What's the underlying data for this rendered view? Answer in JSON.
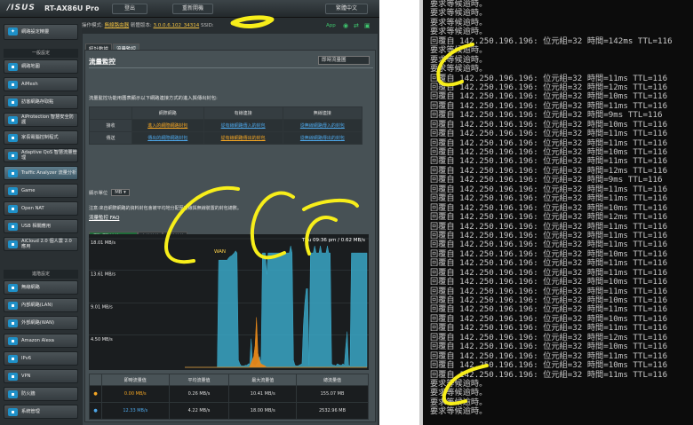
{
  "app": {
    "logo": "/ISUS",
    "model": "RT-AX86U Pro"
  },
  "topbar": {
    "logout": "登出",
    "reboot": "重新開機",
    "language": "繁體中文"
  },
  "infobar": {
    "mode_label": "操作模式:",
    "mode_value": "無線路由器",
    "fw_label": "韌體版本:",
    "fw_value": "3.0.0.6.102_34314",
    "ssid_label": "SSID:",
    "app_label": "App"
  },
  "sidebar": {
    "quick_setup": "網路設定精靈",
    "general_header": "一般設定",
    "general_items": [
      {
        "label": "網路地圖",
        "icon": "map-icon"
      },
      {
        "label": "AiMesh",
        "icon": "mesh-icon"
      },
      {
        "label": "訪客網路存取點",
        "icon": "guest-icon"
      },
      {
        "label": "AiProtection 智慧安全防護",
        "icon": "shield-icon"
      },
      {
        "label": "家長電腦控制程式",
        "icon": "parental-icon"
      },
      {
        "label": "Adaptive QoS 智慧流量管理",
        "icon": "qos-icon"
      },
      {
        "label": "Traffic Analyzer 流量分析",
        "icon": "chart-icon"
      },
      {
        "label": "Game",
        "icon": "game-icon"
      },
      {
        "label": "Open NAT",
        "icon": "nat-icon"
      },
      {
        "label": "USB 相關應用",
        "icon": "usb-icon"
      },
      {
        "label": "AiCloud 2.0 個人雲 2.0 應用",
        "icon": "cloud-icon"
      }
    ],
    "advanced_header": "進階設定",
    "advanced_items": [
      {
        "label": "無線網路",
        "icon": "wifi-icon"
      },
      {
        "label": "內部網路(LAN)",
        "icon": "lan-icon"
      },
      {
        "label": "外部網路(WAN)",
        "icon": "globe-icon"
      },
      {
        "label": "Amazon Alexa",
        "icon": "alexa-icon"
      },
      {
        "label": "IPv6",
        "icon": "ipv6-icon"
      },
      {
        "label": "VPN",
        "icon": "vpn-icon"
      },
      {
        "label": "防火牆",
        "icon": "firewall-icon"
      },
      {
        "label": "系統管理",
        "icon": "admin-icon"
      }
    ]
  },
  "content": {
    "tabs": [
      "統計數據",
      "流量監控"
    ],
    "title": "流量監控",
    "period": "即時流量圖",
    "description": "流量監控功能用圖表顯示以下網路連接方式的進入與傳出封包:",
    "table": {
      "headers": [
        "",
        "網際網路",
        "有線連接",
        "無線連接"
      ],
      "rows": [
        {
          "label": "接收",
          "cells": [
            "進入的網際網路封包",
            "從有線網路傳入的封包",
            "從無線網路傳入的封包"
          ]
        },
        {
          "label": "傳送",
          "cells": [
            "傳出的網際網路封包",
            "從有線網路傳出的封包",
            "從無線網路傳出的封包"
          ]
        }
      ]
    },
    "unit_label": "顯示單位",
    "unit_value": "MB",
    "note": "注意:來自網際網路的資料封包會被平均地分配至有線與無線裝置的封包總數。",
    "faq": "流量監控 FAQ",
    "chart_tabs": [
      "網際網路連線 (WAN)",
      "有線連接",
      "無線連接"
    ],
    "stats": {
      "headers": [
        "",
        "即時流量值",
        "平均流量值",
        "最大流量值",
        "總流量值"
      ],
      "rows": [
        {
          "current": "0.00 MB/s",
          "average": "0.26 MB/s",
          "max": "10.41 MB/s",
          "total": "155.07 MB"
        },
        {
          "current": "12.33 MB/s",
          "average": "4.22 MB/s",
          "max": "18.00 MB/s",
          "total": "2532.96 MB"
        }
      ]
    }
  },
  "chart_data": {
    "type": "area",
    "y_ticks": [
      "18.01 MB/s",
      "13.61 MB/s",
      "9.01 MB/s",
      "4.50 MB/s"
    ],
    "timestamp": "Thu 09:36 pm / 0.62 MB/s",
    "wan_label": "WAN",
    "ylim": [
      0,
      18
    ],
    "series": [
      {
        "color": "#3aa6c6",
        "values": [
          0,
          0,
          0,
          0,
          0,
          0,
          0,
          0,
          0,
          0,
          0,
          0,
          0,
          0,
          0,
          0,
          0,
          0,
          0,
          0,
          0,
          0,
          0,
          0,
          15,
          15,
          15,
          15,
          15,
          15,
          15,
          15.3,
          15.5,
          15.6,
          15.8,
          16,
          16.3,
          16,
          1,
          0.5,
          0.2,
          0.2,
          0.2,
          0.3,
          0.3,
          0.5,
          0.5,
          4,
          0.4,
          0.3,
          0.2,
          0.5,
          0.8,
          1.5,
          0.5,
          16,
          16,
          16,
          13,
          16,
          16,
          16,
          16,
          16,
          16,
          16,
          16,
          16,
          16,
          16,
          16,
          16,
          16,
          16,
          16,
          17,
          16,
          1,
          0.3,
          0.2,
          0.2,
          0.3,
          0.4,
          0.5,
          6,
          9,
          11,
          11,
          0.3,
          16,
          16,
          16,
          17,
          16,
          16,
          16,
          17,
          16,
          16,
          16,
          16,
          17,
          16,
          16,
          0.5,
          0.3,
          0.3,
          0.2,
          0.5,
          0.4,
          0.3,
          0.3,
          0.5,
          0.3,
          3,
          5,
          0.3,
          0.2,
          16,
          16,
          16,
          16,
          16,
          16,
          16,
          16,
          16,
          16,
          16,
          16
        ]
      },
      {
        "color": "#e8891a",
        "values": [
          0,
          0,
          0,
          0,
          0,
          0,
          0,
          0,
          0,
          0,
          0,
          0,
          0,
          0,
          0,
          0,
          0,
          0,
          0,
          0,
          0,
          0,
          0,
          0,
          0,
          0,
          0,
          0,
          0,
          0,
          0,
          0,
          0,
          0,
          0,
          0,
          0,
          0,
          0,
          0,
          0,
          0,
          0,
          0,
          0,
          0,
          0.5,
          1,
          1.5,
          3,
          7,
          2,
          1,
          0.5,
          0.4,
          0.3,
          0.2,
          0,
          0,
          0,
          0,
          0,
          0,
          0,
          0,
          0,
          0,
          0,
          0,
          0,
          0,
          0,
          0,
          0,
          0,
          0,
          0,
          0,
          0,
          0,
          0,
          0,
          0,
          0,
          0,
          0,
          0,
          0,
          0,
          0,
          0,
          0,
          0,
          0,
          0,
          0,
          0,
          0,
          0,
          0,
          0,
          0,
          0,
          0,
          0,
          0,
          0,
          0,
          0,
          0,
          0,
          0,
          0,
          0,
          0,
          0,
          0,
          0,
          0,
          0,
          0,
          0,
          0,
          0,
          0,
          0,
          0,
          0
        ]
      }
    ]
  },
  "console_lines": [
    "要求等候逾時。",
    "要求等候逾時。",
    "要求等候逾時。",
    "要求等候逾時。",
    "回覆自 142.250.196.196: 位元組=32 時間=142ms TTL=116",
    "要求等候逾時。",
    "要求等候逾時。",
    "要求等候逾時。",
    "回覆自 142.250.196.196: 位元組=32 時間=11ms TTL=116",
    "回覆自 142.250.196.196: 位元組=32 時間=12ms TTL=116",
    "回覆自 142.250.196.196: 位元組=32 時間=10ms TTL=116",
    "回覆自 142.250.196.196: 位元組=32 時間=11ms TTL=116",
    "回覆自 142.250.196.196: 位元組=32 時間=9ms TTL=116",
    "回覆自 142.250.196.196: 位元組=32 時間=10ms TTL=116",
    "回覆自 142.250.196.196: 位元組=32 時間=11ms TTL=116",
    "回覆自 142.250.196.196: 位元組=32 時間=11ms TTL=116",
    "回覆自 142.250.196.196: 位元組=32 時間=10ms TTL=116",
    "回覆自 142.250.196.196: 位元組=32 時間=11ms TTL=116",
    "回覆自 142.250.196.196: 位元組=32 時間=12ms TTL=116",
    "回覆自 142.250.196.196: 位元組=32 時間=9ms TTL=116",
    "回覆自 142.250.196.196: 位元組=32 時間=11ms TTL=116",
    "回覆自 142.250.196.196: 位元組=32 時間=11ms TTL=116",
    "回覆自 142.250.196.196: 位元組=32 時間=10ms TTL=116",
    "回覆自 142.250.196.196: 位元組=32 時間=12ms TTL=116",
    "回覆自 142.250.196.196: 位元組=32 時間=11ms TTL=116",
    "回覆自 142.250.196.196: 位元組=32 時間=11ms TTL=116",
    "回覆自 142.250.196.196: 位元組=32 時間=11ms TTL=116",
    "回覆自 142.250.196.196: 位元組=32 時間=10ms TTL=116",
    "回覆自 142.250.196.196: 位元組=32 時間=11ms TTL=116",
    "回覆自 142.250.196.196: 位元組=32 時間=11ms TTL=116",
    "回覆自 142.250.196.196: 位元組=32 時間=10ms TTL=116",
    "回覆自 142.250.196.196: 位元組=32 時間=11ms TTL=116",
    "回覆自 142.250.196.196: 位元組=32 時間=10ms TTL=116",
    "回覆自 142.250.196.196: 位元組=32 時間=11ms TTL=116",
    "回覆自 142.250.196.196: 位元組=32 時間=10ms TTL=116",
    "回覆自 142.250.196.196: 位元組=32 時間=11ms TTL=116",
    "回覆自 142.250.196.196: 位元組=32 時間=12ms TTL=116",
    "回覆自 142.250.196.196: 位元組=32 時間=10ms TTL=116",
    "回覆自 142.250.196.196: 位元組=32 時間=11ms TTL=116",
    "回覆自 142.250.196.196: 位元組=32 時間=10ms TTL=116",
    "回覆自 142.250.196.196: 位元組=32 時間=11ms TTL=116",
    "要求等候逾時。",
    "要求等候逾時。",
    "要求等候逾時。",
    "要求等候逾時。"
  ]
}
